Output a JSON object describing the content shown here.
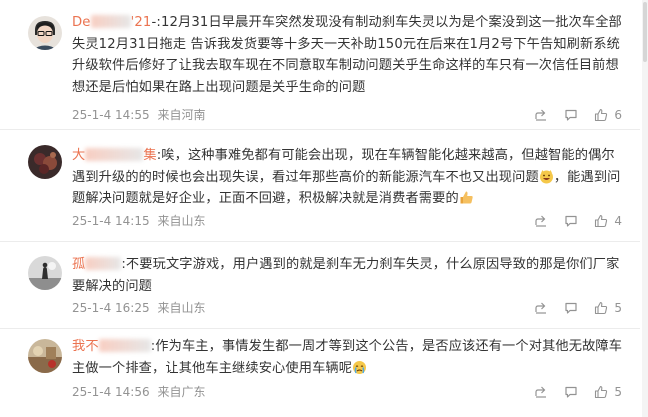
{
  "comments": [
    {
      "user_start": "De",
      "user_end": "'21",
      "text": "-:12月31日早晨开车突然发现没有制动刹车失灵以为是个案没到这一批次车全部失灵12月31日拖走 告诉我发货要等十多天一天补助150元在后来在1月2号下午告知刷新系统升级软件后修好了让我去取车现在不同意取车制动问题关乎生命这样的车只有一次信任目前想想还是后怕如果在路上出现问题是关乎生命的问题",
      "time": "25-1-4 14:55",
      "location": "来自河南",
      "likes": "6"
    },
    {
      "user_start": "大",
      "user_end": "集",
      "text": ":唉，这种事难免都有可能会出现，现在车辆智能化越来越高，但越智能的偶尔遇到升级的的时候也会出现失误，看过年那些高价的新能源汽车不也又出现问题",
      "text_after_emoji": "，能遇到问题解决问题就是好企业，正面不回避，积极解决就是消费者需要的",
      "time": "25-1-4 14:15",
      "location": "来自山东",
      "likes": "4"
    },
    {
      "user_start": "孤",
      "user_end": "",
      "text": ":不要玩文字游戏，用户遇到的就是刹车无力刹车失灵，什么原因导致的那是你们厂家要解决的问题",
      "time": "25-1-4 16:25",
      "location": "来自山东",
      "likes": "5"
    },
    {
      "user_start": "我不",
      "user_end": "",
      "text": ":作为车主，事情发生都一周才等到这个公告，是否应该还有一个对其他无故障车主做一个排查，让其他车主继续安心使用车辆呢",
      "time": "25-1-4 14:56",
      "location": "来自广东",
      "likes": "5"
    }
  ],
  "icons": {
    "share": "share-icon",
    "comment": "comment-icon",
    "like": "thumbs-up-icon",
    "emoji_grin": "grinning-cat-emoji",
    "emoji_thumb": "thumbs-up-emoji",
    "emoji_cry": "crying-face-emoji"
  },
  "colors": {
    "username": "#eb7350",
    "text": "#333333",
    "meta": "#939393",
    "divider": "#ececec"
  }
}
